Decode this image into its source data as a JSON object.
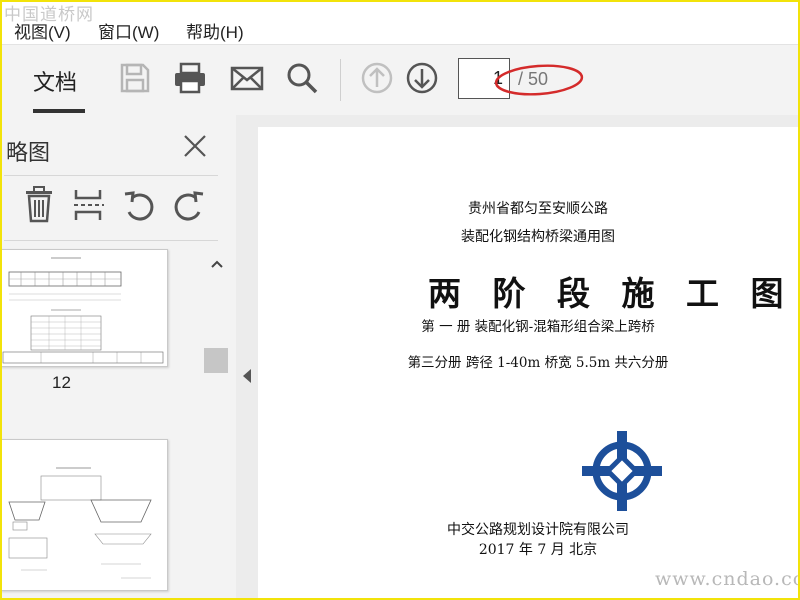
{
  "watermark": {
    "top": "中国道桥网",
    "bottom": "www.cndao.com"
  },
  "menu": {
    "view": "视图(V)",
    "window": "窗口(W)",
    "help": "帮助(H)"
  },
  "toolbar": {
    "tab_label": "文档",
    "icons": [
      "save-icon",
      "print-icon",
      "mail-icon",
      "search-icon",
      "page-up-icon",
      "page-down-icon"
    ],
    "page_current": "1",
    "page_total": "/ 50"
  },
  "sidebar": {
    "title": "略图",
    "icons": [
      "delete-icon",
      "extract-pages-icon",
      "rotate-left-icon",
      "rotate-right-icon"
    ],
    "thumbnails": [
      {
        "label": "12"
      },
      {
        "label": ""
      }
    ]
  },
  "document": {
    "line1": "贵州省都匀至安顺公路",
    "line2": "装配化钢结构桥梁通用图",
    "title": "两 阶 段 施 工 图 设 计",
    "volume": "第 一 册   装配化钢-混箱形组合梁上跨桥",
    "subvolume": "第三分册   跨径 1-40m   桥宽 5.5m      共六分册",
    "org": "中交公路规划设计院有限公司",
    "date": "2017 年 7 月  北京"
  },
  "colors": {
    "accent_red": "#d42b2b",
    "logo_blue": "#1d4f9a",
    "frame_yellow": "#f2e30a"
  }
}
